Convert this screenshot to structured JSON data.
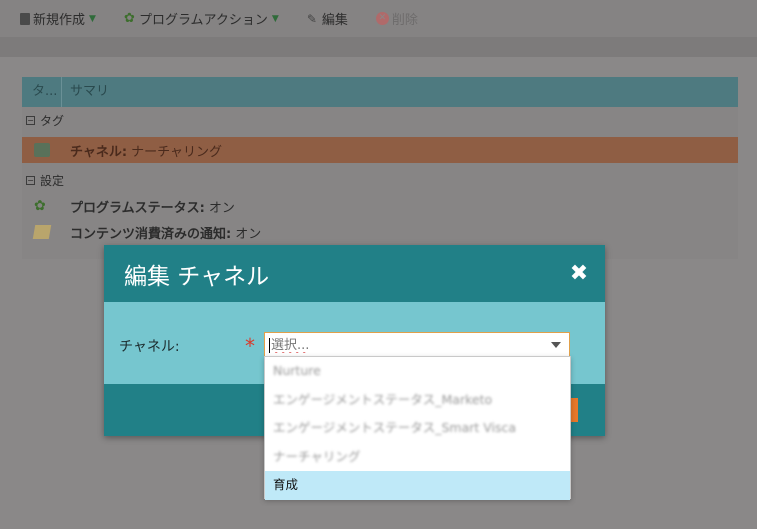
{
  "toolbar": {
    "new_label": "新規作成",
    "program_action_label": "プログラムアクション",
    "edit_label": "編集",
    "delete_label": "削除"
  },
  "grid": {
    "col_type": "タ...",
    "col_summary": "サマリ",
    "groups": [
      {
        "title": "タグ",
        "rows": [
          {
            "key": "チャネル:",
            "value": "ナーチャリング",
            "selected": true,
            "icon": "tag-icon"
          }
        ]
      },
      {
        "title": "設定",
        "rows": [
          {
            "key": "プログラムステータス:",
            "value": "オン",
            "icon": "program-icon"
          },
          {
            "key": "コンテンツ消費済みの通知:",
            "value": "オン",
            "icon": "note-icon"
          }
        ]
      }
    ]
  },
  "dialog": {
    "title": "編集 チャネル",
    "close_glyph": "✖",
    "field_label": "チャネル:",
    "required_mark": "*",
    "select_placeholder": "選択...",
    "options": [
      "Nurture",
      "エンゲージメントステータス_Marketo",
      "エンゲージメントステータス_Smart Visca",
      "ナーチャリング",
      "育成"
    ],
    "highlighted_option": "育成"
  },
  "colors": {
    "dialog_header": "#218087",
    "dialog_body": "#76c6cf",
    "highlight": "#bfe9f8",
    "selected_row": "#8f5e44",
    "required": "#d93a2b"
  }
}
